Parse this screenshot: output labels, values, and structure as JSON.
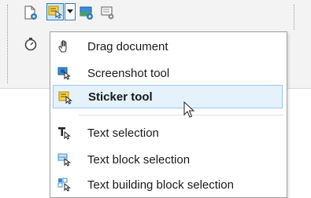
{
  "toolbar": {
    "buttons": [
      {
        "name": "document-settings-icon"
      },
      {
        "name": "sticker-tool-icon",
        "selected": true
      },
      {
        "name": "dropdown-arrow-icon"
      },
      {
        "name": "image-settings-icon"
      },
      {
        "name": "display-settings-icon"
      }
    ],
    "second_row": [
      {
        "name": "stopwatch-icon"
      }
    ]
  },
  "menu": {
    "items": [
      {
        "label": "Drag document",
        "icon": "hand-icon"
      },
      {
        "label": "Screenshot tool",
        "icon": "screenshot-tool-icon"
      },
      {
        "label": "Sticker tool",
        "icon": "sticker-tool-icon",
        "selected": true
      },
      {
        "label": "Text selection",
        "icon": "text-selection-icon"
      },
      {
        "label": "Text block selection",
        "icon": "text-block-selection-icon"
      },
      {
        "label": "Text building block selection",
        "icon": "text-building-block-icon"
      }
    ]
  },
  "colors": {
    "accent": "#2f7dbd",
    "highlight_bg": "#e5f1fb",
    "highlight_border": "#99c9ef",
    "sticker_yellow": "#f6d24a"
  }
}
